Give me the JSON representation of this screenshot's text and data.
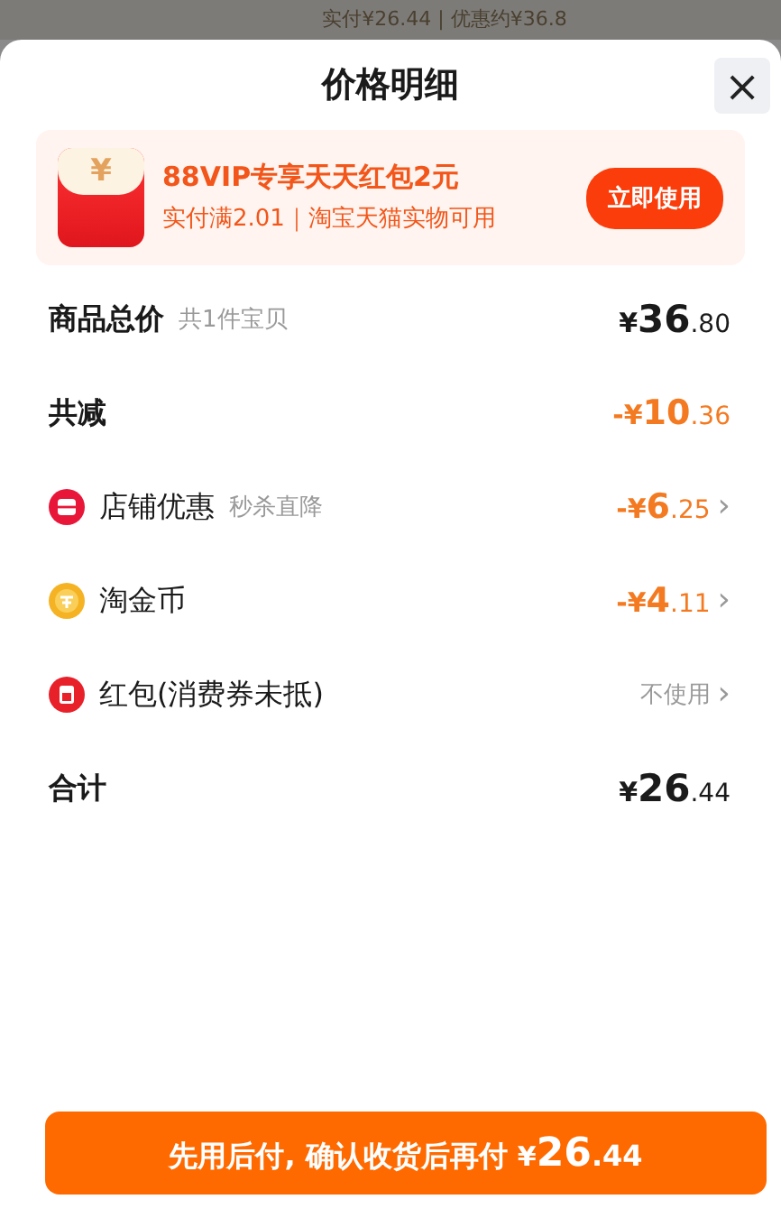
{
  "backdrop": {
    "text": "实付¥26.44 | 优惠约¥36.8"
  },
  "sheet": {
    "title": "价格明细",
    "close": "×"
  },
  "promo": {
    "title": "88VIP专享天天红包2元",
    "subtitle": "实付满2.01｜淘宝天猫实物可用",
    "button": "立即使用",
    "icon_glyph": "¥"
  },
  "rows": [
    {
      "kind": "total",
      "label": "商品总价",
      "note": "共1件宝贝",
      "price": {
        "sign": "¥",
        "integer": "36",
        "decimal": ".80"
      }
    },
    {
      "kind": "reduction",
      "label": "共减",
      "price": {
        "sign": "-¥",
        "integer": "10",
        "decimal": ".36"
      }
    },
    {
      "kind": "shop",
      "label": "店铺优惠",
      "note": "秒杀直降",
      "price": {
        "sign": "-¥",
        "integer": "6",
        "decimal": ".25"
      },
      "chevron": "›"
    },
    {
      "kind": "coin",
      "label": "淘金币",
      "price": {
        "sign": "-¥",
        "integer": "4",
        "decimal": ".11"
      },
      "chevron": "›"
    },
    {
      "kind": "packet",
      "label": "红包(消费券未抵)",
      "value": "不使用",
      "chevron": "›"
    },
    {
      "kind": "total",
      "label": "合计",
      "price": {
        "sign": "¥",
        "integer": "26",
        "decimal": ".44"
      }
    }
  ],
  "pay_button": {
    "label": "先用后付, 确认收货后再付 ",
    "price": {
      "sign": "¥",
      "integer": "26",
      "decimal": ".44"
    }
  }
}
